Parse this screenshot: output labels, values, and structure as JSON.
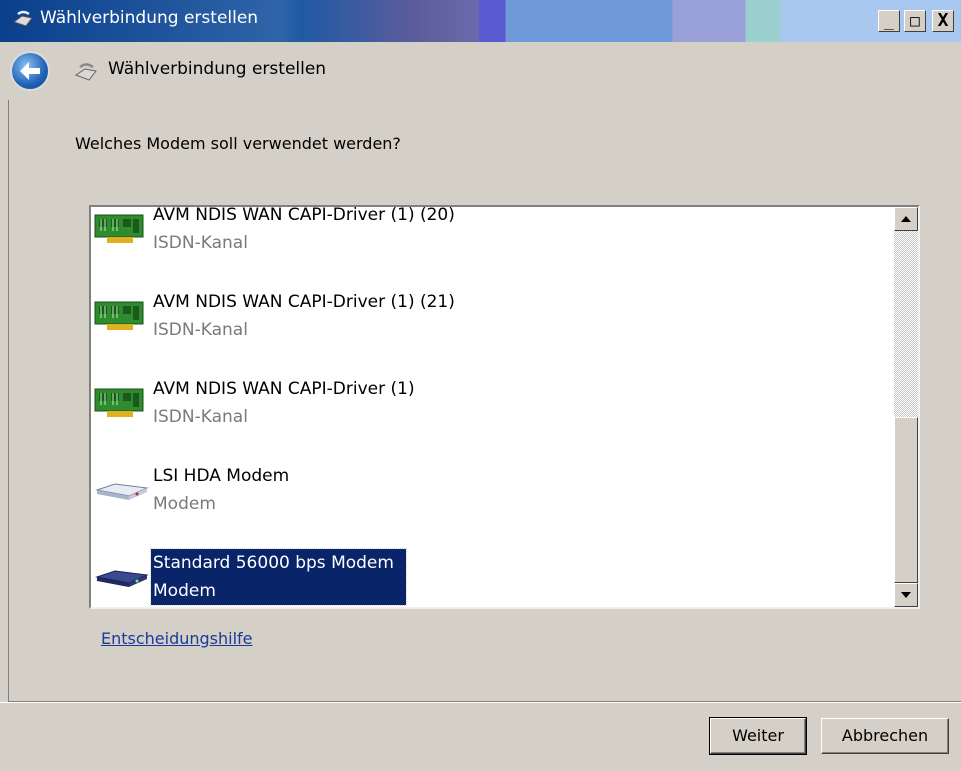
{
  "window": {
    "title": "Wählverbindung erstellen",
    "controls": {
      "minimize": "_",
      "maximize": "□",
      "close": "X"
    }
  },
  "header": {
    "title": "Wählverbindung erstellen",
    "back_icon": "back-arrow-icon",
    "wizard_icon": "phone-modem-icon"
  },
  "content": {
    "question": "Welches Modem soll verwendet werden?",
    "help_link": "Entscheidungshilfe"
  },
  "modems": [
    {
      "name": "AVM NDIS WAN CAPI-Driver (1) (20)",
      "type": "ISDN-Kanal",
      "icon": "isdn-card-icon",
      "selected": false
    },
    {
      "name": "AVM NDIS WAN CAPI-Driver (1) (21)",
      "type": "ISDN-Kanal",
      "icon": "isdn-card-icon",
      "selected": false
    },
    {
      "name": "AVM NDIS WAN CAPI-Driver (1)",
      "type": "ISDN-Kanal",
      "icon": "isdn-card-icon",
      "selected": false
    },
    {
      "name": "LSI HDA Modem",
      "type": "Modem",
      "icon": "modem-light-icon",
      "selected": false
    },
    {
      "name": "Standard 56000 bps Modem",
      "type": "Modem",
      "icon": "modem-dark-icon",
      "selected": true
    }
  ],
  "buttons": {
    "next": "Weiter",
    "cancel": "Abbrechen"
  },
  "colors": {
    "selection": "#0a246a",
    "link": "#1a3a9a",
    "dialog_bg": "#d4d0c8"
  }
}
